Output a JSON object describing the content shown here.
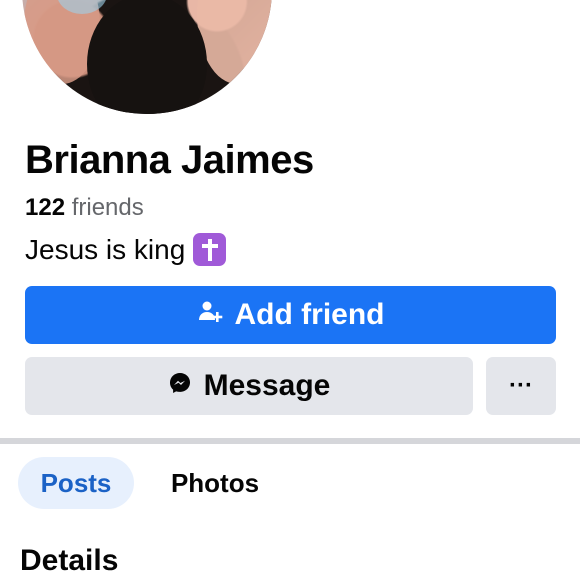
{
  "profile": {
    "name": "Brianna Jaimes",
    "friends_count": "122",
    "friends_label": "friends",
    "bio": "Jesus is king"
  },
  "actions": {
    "add_friend_label": "Add friend",
    "message_label": "Message",
    "more_label": "···"
  },
  "tabs": [
    {
      "label": "Posts",
      "active": true
    },
    {
      "label": "Photos",
      "active": false
    }
  ],
  "sections": {
    "details_title": "Details"
  },
  "icons": {
    "add_friend": "add-friend-icon",
    "message": "messenger-icon",
    "bio_emoji": "latin-cross-emoji"
  },
  "colors": {
    "primary": "#1b74f5",
    "secondary_button": "#e4e6eb",
    "active_tab_bg": "#e7f0fd",
    "active_tab_text": "#1b62c6",
    "emoji_bg": "#a05ad8"
  }
}
